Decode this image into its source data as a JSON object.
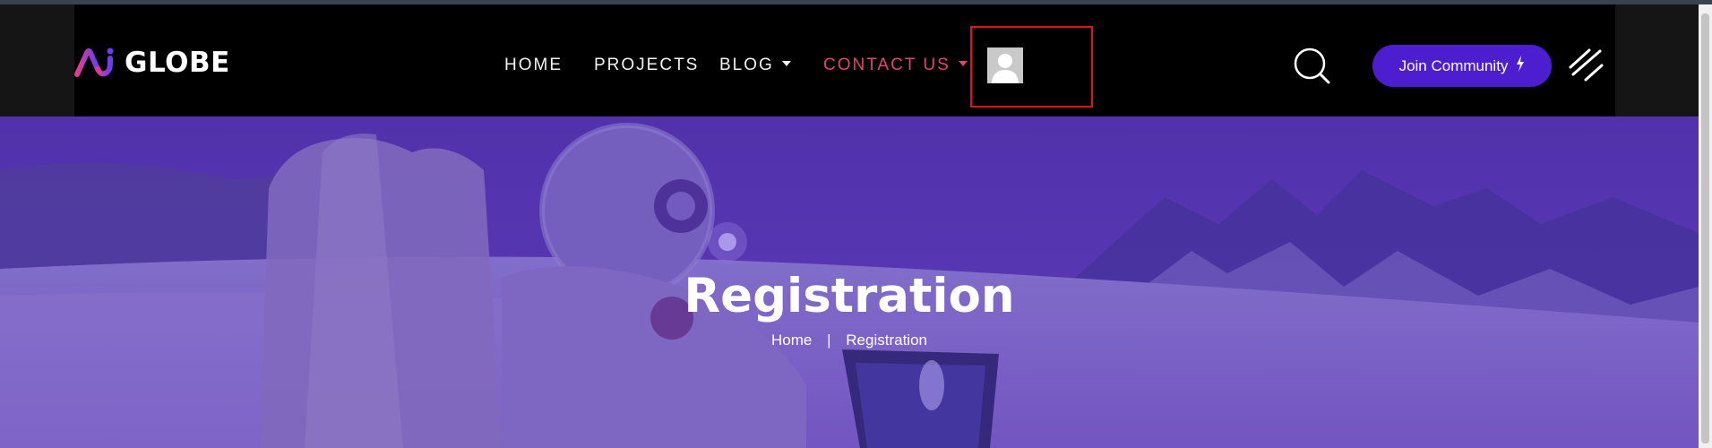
{
  "brand": {
    "logo_text": "GLOBE"
  },
  "nav": {
    "items": [
      {
        "label": "HOME",
        "has_dropdown": false
      },
      {
        "label": "PROJECTS",
        "has_dropdown": false
      },
      {
        "label": "BLOG",
        "has_dropdown": true
      },
      {
        "label": "CONTACT US",
        "has_dropdown": true,
        "active": true
      }
    ]
  },
  "header": {
    "join_label": "Join Community"
  },
  "hero": {
    "title": "Registration",
    "breadcrumb": {
      "home": "Home",
      "separator": "|",
      "current": "Registration"
    }
  },
  "colors": {
    "accent": "#4d1ed0",
    "active_nav": "#e0476a",
    "highlight_box": "#e0141a",
    "hero_tint": "#5b3ab8"
  },
  "icons": [
    "globe-logo-icon",
    "user-avatar-icon",
    "search-icon",
    "bolt-icon",
    "menu-lines-icon"
  ]
}
